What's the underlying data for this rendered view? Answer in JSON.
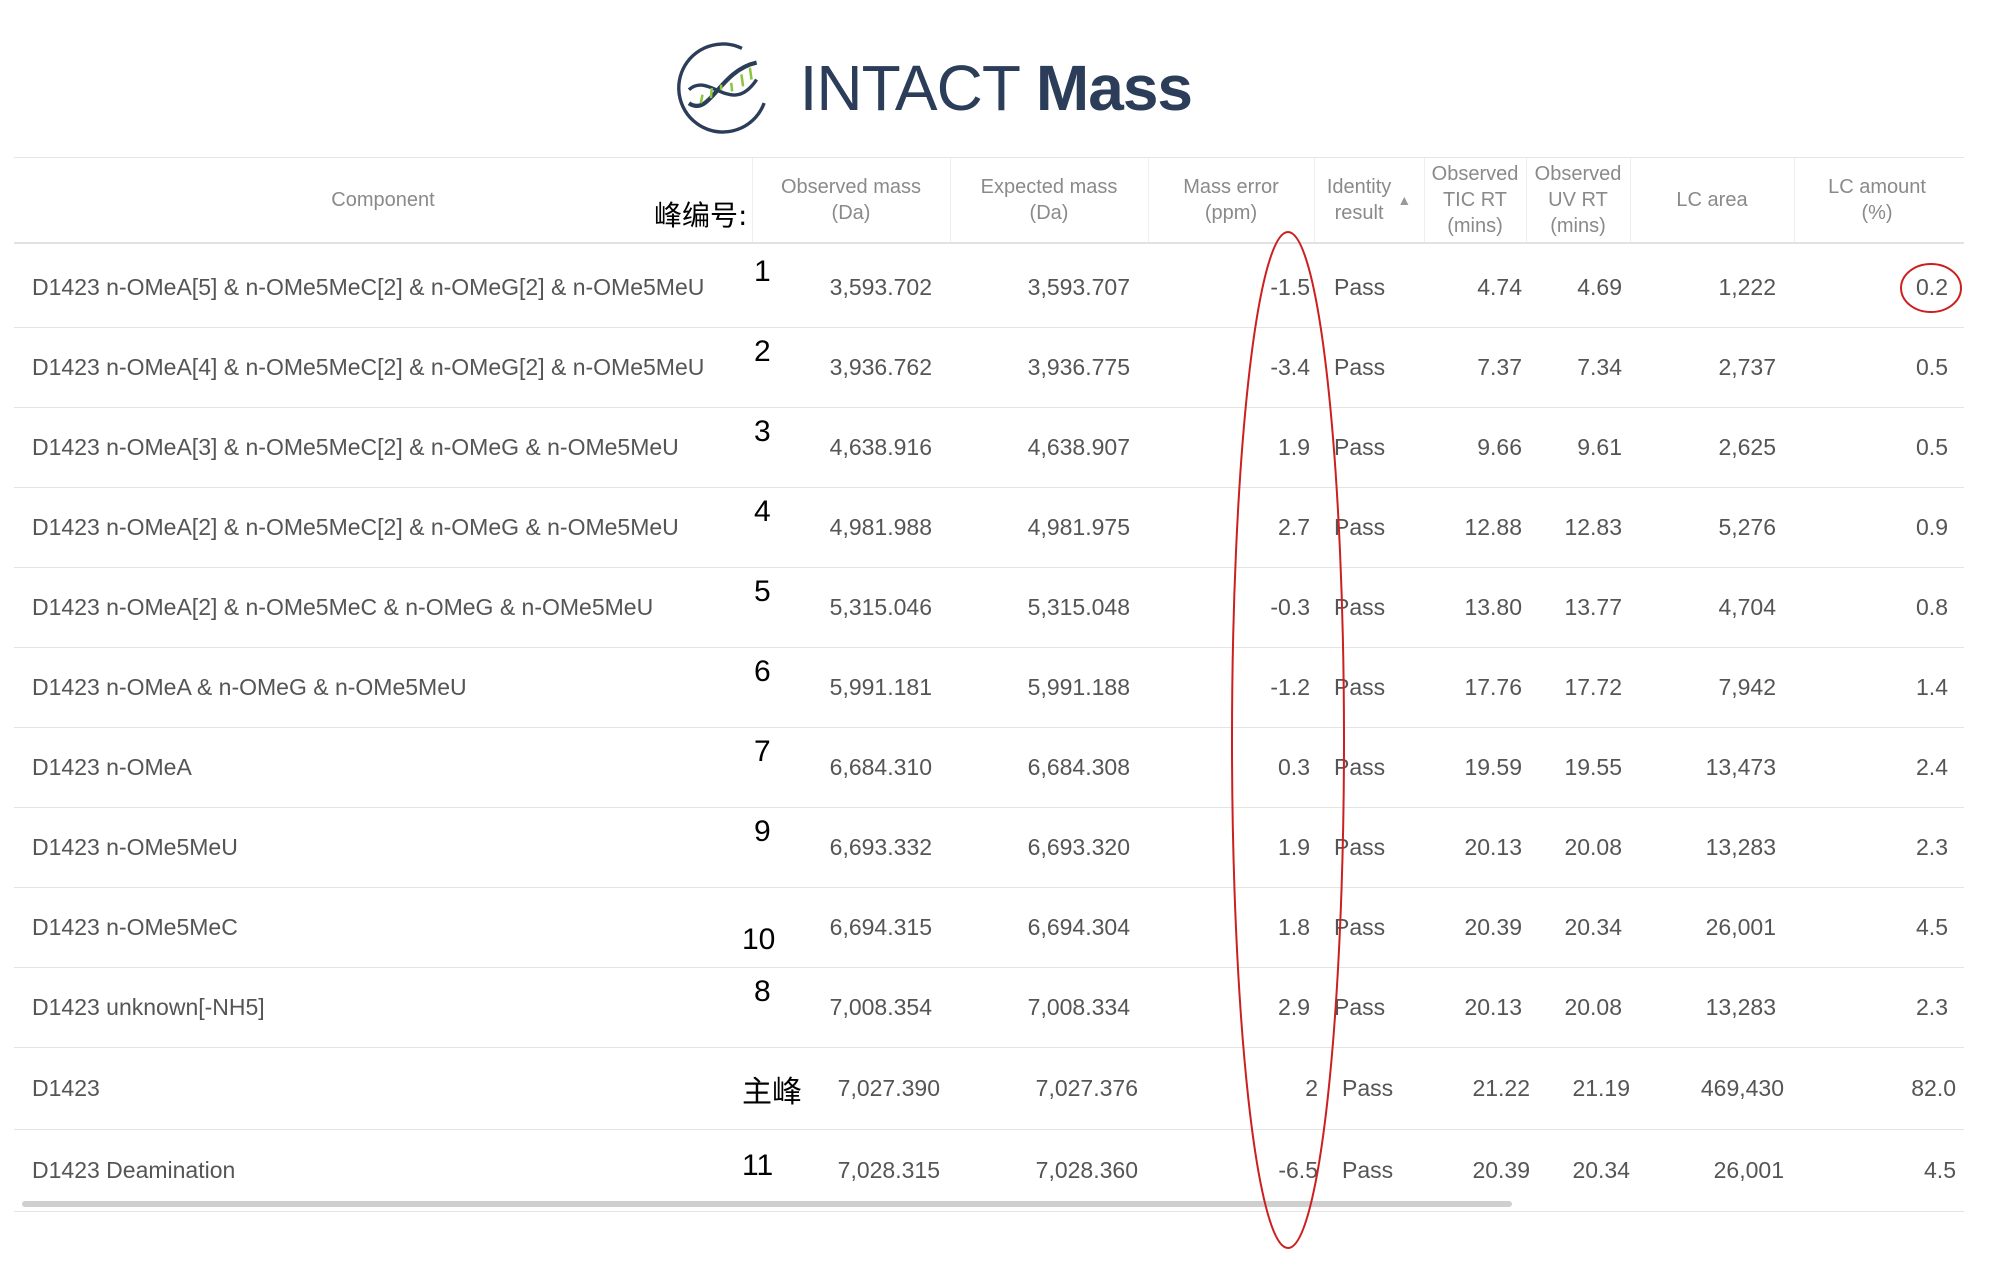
{
  "logo": {
    "text_light": "INTACT",
    "text_bold": "Mass"
  },
  "peak_label": "峰编号:",
  "columns": [
    {
      "label": "Component",
      "align": "center"
    },
    {
      "label": "Observed mass (Da)",
      "line1": "Observed mass",
      "line2": "(Da)"
    },
    {
      "label": "Expected mass (Da)",
      "line1": "Expected mass",
      "line2": "(Da)"
    },
    {
      "label": "Mass error (ppm)",
      "line1": "Mass error",
      "line2": "(ppm)"
    },
    {
      "label": "Identity result",
      "line1": "Identity",
      "line2": "result",
      "sort": "▲"
    },
    {
      "label": "Observed TIC RT (mins)",
      "line1": "Observed",
      "line2": "TIC RT",
      "line3": "(mins)"
    },
    {
      "label": "Observed UV RT (mins)",
      "line1": "Observed",
      "line2": "UV RT",
      "line3": "(mins)"
    },
    {
      "label": "LC area",
      "line1": "LC area"
    },
    {
      "label": "LC amount (%)",
      "line1": "LC amount",
      "line2": "(%)"
    }
  ],
  "rows": [
    {
      "component": "D1423 n-OMeA[5] & n-OMe5MeC[2] & n-OMeG[2] & n-OMe5MeU",
      "peak": "1",
      "observed": "3,593.702",
      "expected": "3,593.707",
      "error": "-1.5",
      "identity": "Pass",
      "tic": "4.74",
      "uv": "4.69",
      "area": "1,222",
      "amount": "0.2"
    },
    {
      "component": "D1423 n-OMeA[4] & n-OMe5MeC[2] & n-OMeG[2] & n-OMe5MeU",
      "peak": "2",
      "observed": "3,936.762",
      "expected": "3,936.775",
      "error": "-3.4",
      "identity": "Pass",
      "tic": "7.37",
      "uv": "7.34",
      "area": "2,737",
      "amount": "0.5"
    },
    {
      "component": "D1423 n-OMeA[3] & n-OMe5MeC[2] & n-OMeG & n-OMe5MeU",
      "peak": "3",
      "observed": "4,638.916",
      "expected": "4,638.907",
      "error": "1.9",
      "identity": "Pass",
      "tic": "9.66",
      "uv": "9.61",
      "area": "2,625",
      "amount": "0.5"
    },
    {
      "component": "D1423 n-OMeA[2] & n-OMe5MeC[2] & n-OMeG & n-OMe5MeU",
      "peak": "4",
      "observed": "4,981.988",
      "expected": "4,981.975",
      "error": "2.7",
      "identity": "Pass",
      "tic": "12.88",
      "uv": "12.83",
      "area": "5,276",
      "amount": "0.9"
    },
    {
      "component": "D1423 n-OMeA[2] & n-OMe5MeC & n-OMeG & n-OMe5MeU",
      "peak": "5",
      "observed": "5,315.046",
      "expected": "5,315.048",
      "error": "-0.3",
      "identity": "Pass",
      "tic": "13.80",
      "uv": "13.77",
      "area": "4,704",
      "amount": "0.8"
    },
    {
      "component": "D1423 n-OMeA & n-OMeG & n-OMe5MeU",
      "peak": "6",
      "observed": "5,991.181",
      "expected": "5,991.188",
      "error": "-1.2",
      "identity": "Pass",
      "tic": "17.76",
      "uv": "17.72",
      "area": "7,942",
      "amount": "1.4"
    },
    {
      "component": "D1423 n-OMeA",
      "peak": "7",
      "observed": "6,684.310",
      "expected": "6,684.308",
      "error": "0.3",
      "identity": "Pass",
      "tic": "19.59",
      "uv": "19.55",
      "area": "13,473",
      "amount": "2.4"
    },
    {
      "component": "D1423 n-OMe5MeU",
      "peak": "9",
      "observed": "6,693.332",
      "expected": "6,693.320",
      "error": "1.9",
      "identity": "Pass",
      "tic": "20.13",
      "uv": "20.08",
      "area": "13,283",
      "amount": "2.3"
    },
    {
      "component": "D1423 n-OMe5MeC",
      "peak": "10",
      "observed": "6,694.315",
      "expected": "6,694.304",
      "error": "1.8",
      "identity": "Pass",
      "tic": "20.39",
      "uv": "20.34",
      "area": "26,001",
      "amount": "4.5"
    },
    {
      "component": "D1423 unknown[-NH5]",
      "peak": "8",
      "observed": "7,008.354",
      "expected": "7,008.334",
      "error": "2.9",
      "identity": "Pass",
      "tic": "20.13",
      "uv": "20.08",
      "area": "13,283",
      "amount": "2.3"
    },
    {
      "component": "D1423",
      "peak": "主峰",
      "observed": "7,027.390",
      "expected": "7,027.376",
      "error": "2",
      "identity": "Pass",
      "tic": "21.22",
      "uv": "21.19",
      "area": "469,430",
      "amount": "82.0"
    },
    {
      "component": "D1423 Deamination",
      "peak": "11",
      "observed": "7,028.315",
      "expected": "7,028.360",
      "error": "-6.5",
      "identity": "Pass",
      "tic": "20.39",
      "uv": "20.34",
      "area": "26,001",
      "amount": "4.5"
    }
  ],
  "colors": {
    "annotation": "#cc1f1f",
    "header_text": "#8a8a8a",
    "cell_text": "#555555",
    "logo_text": "#2b3d59",
    "logo_green": "#8cc63f"
  },
  "icons": [
    "dna-logo-icon",
    "sort-asc-icon"
  ]
}
